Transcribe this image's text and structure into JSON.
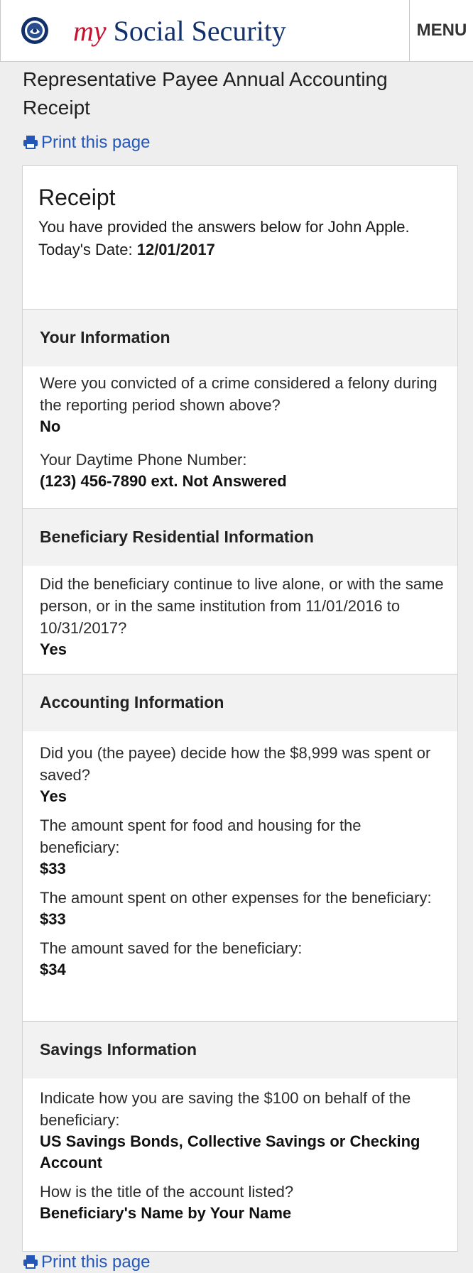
{
  "header": {
    "brand_my": "my",
    "brand_rest": "Social Security",
    "menu_label": "MENU"
  },
  "page": {
    "title": "Representative Payee Annual Accounting Receipt",
    "print_label": "Print this page"
  },
  "receipt": {
    "heading": "Receipt",
    "intro": "You have provided the answers below for John Apple.",
    "date_label": "Today's Date: ",
    "date_value": "12/01/2017"
  },
  "sections": {
    "your_info": {
      "title": "Your Information",
      "q1": "Were you convicted of a crime considered a felony during the reporting period shown above?",
      "a1": "No",
      "q2": "Your Daytime Phone Number:",
      "a2": "(123) 456-7890 ext. Not Answered"
    },
    "residential": {
      "title": "Beneficiary Residential Information",
      "q1": "Did the beneficiary continue to live alone, or with the same person, or in the same institution from 11/01/2016 to 10/31/2017?",
      "a1": "Yes"
    },
    "accounting": {
      "title": "Accounting Information",
      "q1": "Did you (the payee) decide how the $8,999 was spent or saved?",
      "a1": "Yes",
      "q2": "The amount spent for food and housing for the beneficiary:",
      "a2": "$33",
      "q3": "The amount spent on other expenses for the beneficiary:",
      "a3": "$33",
      "q4": "The amount saved for the beneficiary:",
      "a4": "$34"
    },
    "savings": {
      "title": "Savings Information",
      "q1": "Indicate how you are saving the $100 on behalf of the beneficiary:",
      "a1": "US Savings Bonds, Collective Savings or Checking Account",
      "q2": "How is the title of the account listed?",
      "a2": "Beneficiary's Name by Your Name"
    }
  },
  "colors": {
    "brand_blue": "#12316b",
    "brand_red": "#c8102e",
    "link_blue": "#2456b8"
  }
}
